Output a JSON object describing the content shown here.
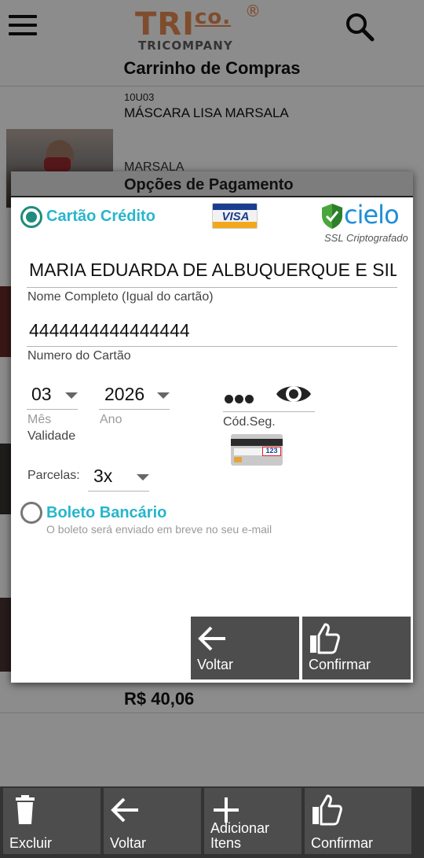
{
  "header": {
    "logo_main": "TRI",
    "logo_co": "co.",
    "logo_reg": "®",
    "logo_sub": "TRICOMPANY",
    "page_title": "Carrinho de Compras"
  },
  "cart_item": {
    "code": "10U03",
    "name": "MÁSCARA LISA MARSALA",
    "color": "MARSALA",
    "price": "R$ 40,06"
  },
  "dialog": {
    "title": "Opções de Pagamento",
    "credit_option": {
      "label": "Cartão Crédito",
      "selected": true,
      "brand": "VISA",
      "gateway": "cielo",
      "ssl_text": "SSL Criptografado"
    },
    "full_name": {
      "value": "MARIA EDUARDA DE ALBUQUERQUE E SILVA",
      "label": "Nome Completo (Igual do cartão)"
    },
    "card_number": {
      "value": "4444444444444444",
      "label": "Numero do Cartão"
    },
    "expiry": {
      "month": "03",
      "month_label": "Mês",
      "year": "2026",
      "year_label": "Ano",
      "label": "Validade"
    },
    "security_code": {
      "label": "Cód.Seg.",
      "card_hint": "123"
    },
    "installments": {
      "label": "Parcelas:",
      "value": "3x"
    },
    "boleto_option": {
      "label": "Boleto Bancário",
      "hint": "O boleto será enviado em breve no seu e-mail",
      "selected": false
    },
    "buttons": {
      "back": "Voltar",
      "confirm": "Confirmar"
    }
  },
  "bottom_bar": {
    "delete": "Excluir",
    "back": "Voltar",
    "add_items": "Adicionar Itens",
    "confirm": "Confirmar"
  },
  "colors": {
    "accent": "#27b6cc",
    "radio_selected": "#1f8c7c",
    "logo": "#e88a52",
    "button_bg": "#4d4d4d"
  },
  "icons": {
    "menu": "hamburger-menu-icon",
    "search": "search-icon",
    "eye": "eye-icon",
    "back": "arrow-left-icon",
    "confirm": "thumbs-up-icon",
    "delete": "trash-icon",
    "add": "plus-icon"
  }
}
